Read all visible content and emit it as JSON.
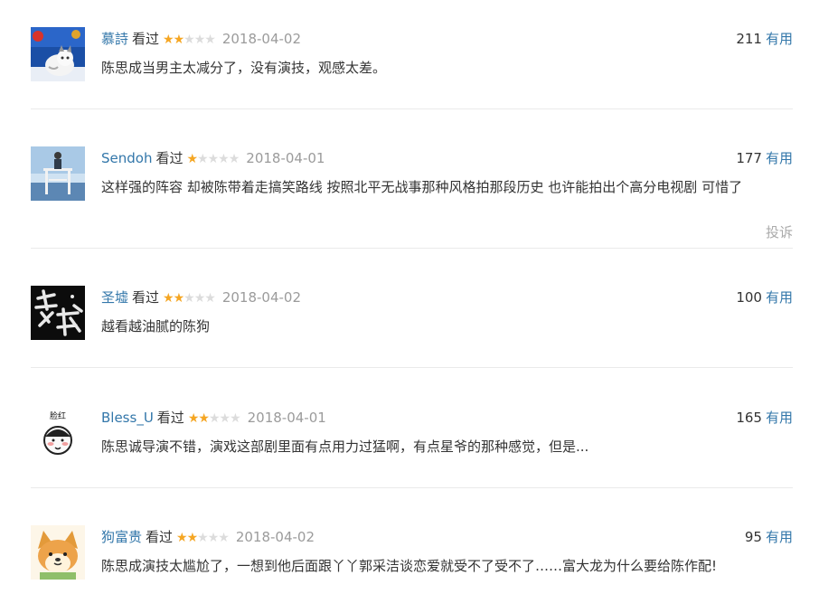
{
  "comments": [
    {
      "user": "慕詩",
      "status": "看过",
      "rating": 2,
      "date": "2018-04-02",
      "votes": "211",
      "useful_label": "有用",
      "text": "陈思成当男主太减分了，没有演技，观感太差。",
      "avatar": "avatar-photo-cat"
    },
    {
      "user": "Sendoh",
      "status": "看过",
      "rating": 1,
      "date": "2018-04-01",
      "votes": "177",
      "useful_label": "有用",
      "text": "这样强的阵容 却被陈带着走搞笑路线 按照北平无战事那种风格拍那段历史 也许能拍出个高分电视剧 可惜了",
      "report_label": "投诉",
      "avatar": "avatar-photo-lifeguard"
    },
    {
      "user": "圣墟",
      "status": "看过",
      "rating": 2,
      "date": "2018-04-02",
      "votes": "100",
      "useful_label": "有用",
      "text": "越看越油腻的陈狗",
      "avatar": "avatar-calligraphy"
    },
    {
      "user": "Bless_U",
      "status": "看过",
      "rating": 2,
      "date": "2018-04-01",
      "votes": "165",
      "useful_label": "有用",
      "text": "陈思诚导演不错，演戏这部剧里面有点用力过猛啊，有点星爷的那种感觉，但是...",
      "avatar_caption": "脸红",
      "avatar": "avatar-cartoon-face"
    },
    {
      "user": "狗富贵",
      "status": "看过",
      "rating": 2,
      "date": "2018-04-02",
      "votes": "95",
      "useful_label": "有用",
      "text": "陈思成演技太尴尬了，一想到他后面跟丫丫郭采洁谈恋爱就受不了受不了……富大龙为什么要给陈作配!",
      "avatar": "avatar-cartoon-dog"
    }
  ],
  "colors": {
    "link": "#3377aa",
    "star_on": "#f5a623",
    "star_off": "#dcdcdc",
    "date": "#9b9b9b",
    "divider": "#eaeaea"
  }
}
